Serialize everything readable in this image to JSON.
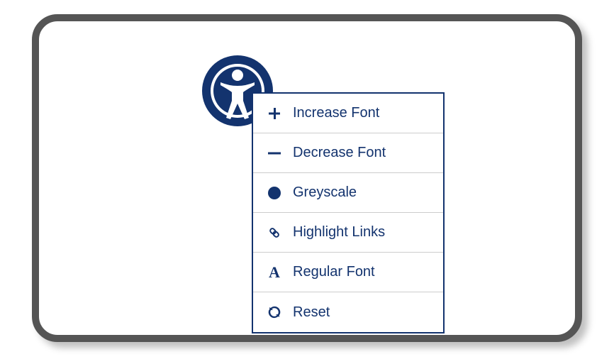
{
  "colors": {
    "accent": "#13336e"
  },
  "menu": {
    "items": [
      {
        "icon": "plus-icon",
        "label": "Increase Font"
      },
      {
        "icon": "minus-icon",
        "label": "Decrease Font"
      },
      {
        "icon": "circle-icon",
        "label": "Greyscale"
      },
      {
        "icon": "link-icon",
        "label": "Highlight Links"
      },
      {
        "icon": "font-a-icon",
        "label": "Regular Font"
      },
      {
        "icon": "refresh-icon",
        "label": "Reset"
      }
    ]
  }
}
